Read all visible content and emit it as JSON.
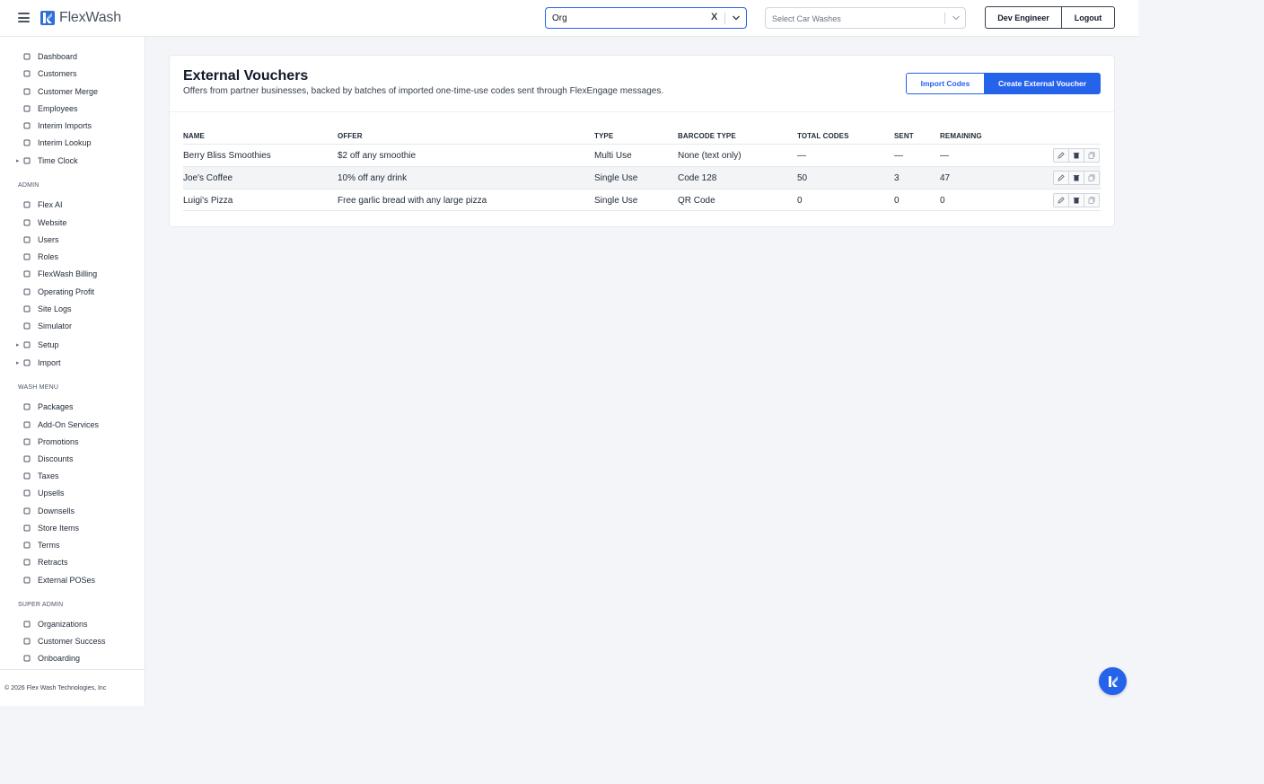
{
  "header": {
    "brand": "FlexWash",
    "org_select": {
      "value": "Org",
      "clear": "X"
    },
    "carwash_select": {
      "placeholder": "Select Car Washes"
    },
    "user_button": "Dev Engineer",
    "logout_button": "Logout"
  },
  "sidebar": {
    "main": [
      {
        "label": "Dashboard",
        "icon": "grid-icon"
      },
      {
        "label": "Customers",
        "icon": "users-icon"
      },
      {
        "label": "Customer Merge",
        "icon": "merge-icon"
      },
      {
        "label": "Employees",
        "icon": "briefcase-icon"
      },
      {
        "label": "Interim Imports",
        "icon": "list-icon"
      },
      {
        "label": "Interim Lookup",
        "icon": "user-search-icon"
      },
      {
        "label": "Time Clock",
        "icon": "clock-icon",
        "expandable": true
      }
    ],
    "admin_heading": "ADMIN",
    "admin": [
      {
        "label": "Flex AI",
        "icon": "sparkle-icon"
      },
      {
        "label": "Website",
        "icon": "browser-icon"
      },
      {
        "label": "Users",
        "icon": "user-circle-icon"
      },
      {
        "label": "Roles",
        "icon": "shield-icon"
      },
      {
        "label": "FlexWash Billing",
        "icon": "receipt-icon"
      },
      {
        "label": "Operating Profit",
        "icon": "calculator-icon"
      },
      {
        "label": "Site Logs",
        "icon": "clipboard-icon"
      },
      {
        "label": "Simulator",
        "icon": "square-icon"
      },
      {
        "label": "Setup",
        "icon": "film-icon",
        "expandable": true
      },
      {
        "label": "Import",
        "icon": "file-icon",
        "expandable": true
      }
    ],
    "wash_heading": "WASH MENU",
    "wash": [
      {
        "label": "Packages",
        "icon": "boxes-icon"
      },
      {
        "label": "Add-On Services",
        "icon": "addon-icon"
      },
      {
        "label": "Promotions",
        "icon": "tag-icon"
      },
      {
        "label": "Discounts",
        "icon": "discount-icon"
      },
      {
        "label": "Taxes",
        "icon": "bank-icon"
      },
      {
        "label": "Upsells",
        "icon": "arrow-up-down-icon"
      },
      {
        "label": "Downsells",
        "icon": "cart-icon"
      },
      {
        "label": "Store Items",
        "icon": "store-icon"
      },
      {
        "label": "Terms",
        "icon": "terms-icon"
      },
      {
        "label": "Retracts",
        "icon": "retract-icon"
      },
      {
        "label": "External POSes",
        "icon": "pos-icon"
      }
    ],
    "super_heading": "SUPER ADMIN",
    "super": [
      {
        "label": "Organizations",
        "icon": "building-icon"
      },
      {
        "label": "Customer Success",
        "icon": "chart-line-icon"
      },
      {
        "label": "Onboarding",
        "icon": "checklist-icon"
      }
    ],
    "footer": "© 2026 Flex Wash Technologies, Inc"
  },
  "page": {
    "title": "External Vouchers",
    "subtitle": "Offers from partner businesses, backed by batches of imported one-time-use codes sent through FlexEngage messages.",
    "import_button": "Import Codes",
    "create_button": "Create External Voucher"
  },
  "table": {
    "columns": [
      "NAME",
      "OFFER",
      "TYPE",
      "BARCODE TYPE",
      "TOTAL CODES",
      "SENT",
      "REMAINING"
    ],
    "rows": [
      [
        "Berry Bliss Smoothies",
        "$2 off any smoothie",
        "Multi Use",
        "None (text only)",
        "—",
        "—",
        "—"
      ],
      [
        "Joe's Coffee",
        "10% off any drink",
        "Single Use",
        "Code 128",
        "50",
        "3",
        "47"
      ],
      [
        "Luigi's Pizza",
        "Free garlic bread with any large pizza",
        "Single Use",
        "QR Code",
        "0",
        "0",
        "0"
      ]
    ]
  },
  "colors": {
    "primary": "#2563eb",
    "background": "#f3f5f8"
  }
}
